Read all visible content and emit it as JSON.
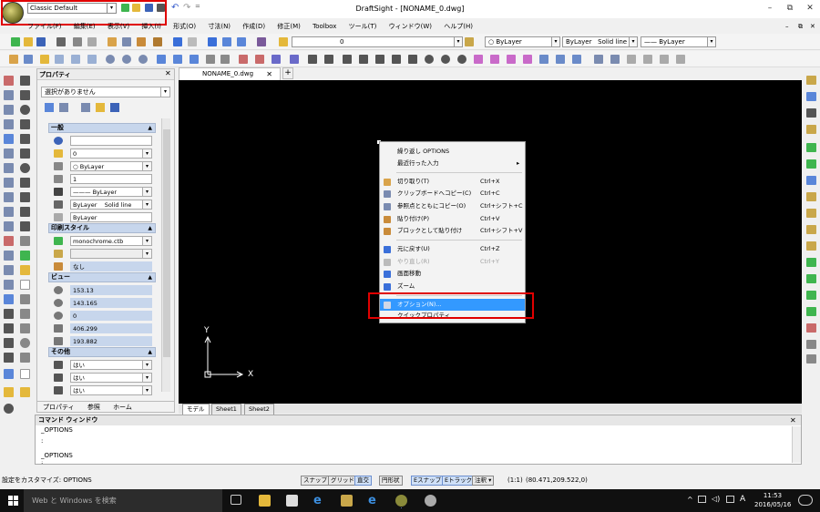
{
  "window": {
    "title": "DraftSight - [NONAME_0.dwg]",
    "workspace": "Classic Default"
  },
  "menu": [
    "ファイル(F)",
    "編集(E)",
    "表示(V)",
    "挿入(I)",
    "形式(O)",
    "寸法(N)",
    "作成(D)",
    "修正(M)",
    "Toolbox",
    "ツール(T)",
    "ウィンドウ(W)",
    "ヘルプ(H)"
  ],
  "toolbar": {
    "layer_value": "0",
    "color_value": "ByLayer",
    "linestyle_value": "ByLayer",
    "linestyle_name": "Solid line",
    "lineweight_value": "ByLayer"
  },
  "properties": {
    "title": "プロパティ",
    "selection": "選択がありません",
    "sections": {
      "general": "一般",
      "print_style": "印刷スタイル",
      "view": "ビュー",
      "other": "その他"
    },
    "general": [
      "",
      "0",
      "ByLayer",
      "1",
      "ByLayer",
      "ByLayer",
      "Solid line",
      "ByLayer"
    ],
    "print": [
      "monochrome.ctb",
      "",
      "なし"
    ],
    "view": [
      "153.13",
      "143.165",
      "0",
      "406.299",
      "193.882"
    ],
    "other": [
      "はい",
      "はい",
      "はい"
    ],
    "tabs": [
      "プロパティ",
      "参照",
      "ホーム"
    ]
  },
  "doc_tab": "NONAME_0.dwg",
  "sheet_tabs": [
    "モデル",
    "Sheet1",
    "Sheet2"
  ],
  "axis": {
    "x": "X",
    "y": "Y"
  },
  "context_menu": {
    "items": [
      {
        "label": "繰り返し OPTIONS",
        "shortcut": "",
        "state": "normal",
        "color": ""
      },
      {
        "label": "最近行った入力",
        "shortcut": "▸",
        "state": "normal",
        "color": ""
      },
      {
        "label": "切り取り(T)",
        "shortcut": "Ctrl+X",
        "state": "normal",
        "color": "#d9a34a"
      },
      {
        "label": "クリップボードへコピー(C)",
        "shortcut": "Ctrl+C",
        "state": "normal",
        "color": "#7a8bb0"
      },
      {
        "label": "参照点とともにコピー(O)",
        "shortcut": "Ctrl+シフト+C",
        "state": "normal",
        "color": "#7a8bb0"
      },
      {
        "label": "貼り付け(P)",
        "shortcut": "Ctrl+V",
        "state": "normal",
        "color": "#c98b3a"
      },
      {
        "label": "ブロックとして貼り付け",
        "shortcut": "Ctrl+シフト+V",
        "state": "normal",
        "color": "#c98b3a"
      },
      {
        "label": "元に戻す(U)",
        "shortcut": "Ctrl+Z",
        "state": "normal",
        "color": "#3a6fd9"
      },
      {
        "label": "やり直し(R)",
        "shortcut": "Ctrl+Y",
        "state": "disabled",
        "color": "#bbbbbb"
      },
      {
        "label": "画面移動",
        "shortcut": "",
        "state": "normal",
        "color": "#3a6fd9"
      },
      {
        "label": "ズーム",
        "shortcut": "",
        "state": "normal",
        "color": "#3a6fd9"
      },
      {
        "label": "オプション(N)...",
        "shortcut": "",
        "state": "highlighted",
        "color": "#cfd7e6"
      },
      {
        "label": "クイックプロパティ",
        "shortcut": "",
        "state": "normal",
        "color": ""
      }
    ]
  },
  "command_window": {
    "title": "コマンド ウィンドウ",
    "lines": [
      "_OPTIONS",
      ":",
      "_OPTIONS",
      ":"
    ]
  },
  "status": {
    "left_text": "設定をカスタマイズ: OPTIONS",
    "buttons": [
      {
        "label": "スナップ",
        "on": false
      },
      {
        "label": "グリッド",
        "on": false
      },
      {
        "label": "直交",
        "on": true
      },
      {
        "label": "円形状",
        "on": false
      },
      {
        "label": "Eスナップ",
        "on": true
      },
      {
        "label": "Eトラック",
        "on": true
      },
      {
        "label": "注釈 ▾",
        "on": false
      }
    ],
    "scale": "(1:1)",
    "coords": "(80.471,209.522,0)"
  },
  "taskbar": {
    "search_placeholder": "Web と Windows を検索",
    "ime": "A",
    "time": "11:53",
    "date": "2016/05/16"
  }
}
